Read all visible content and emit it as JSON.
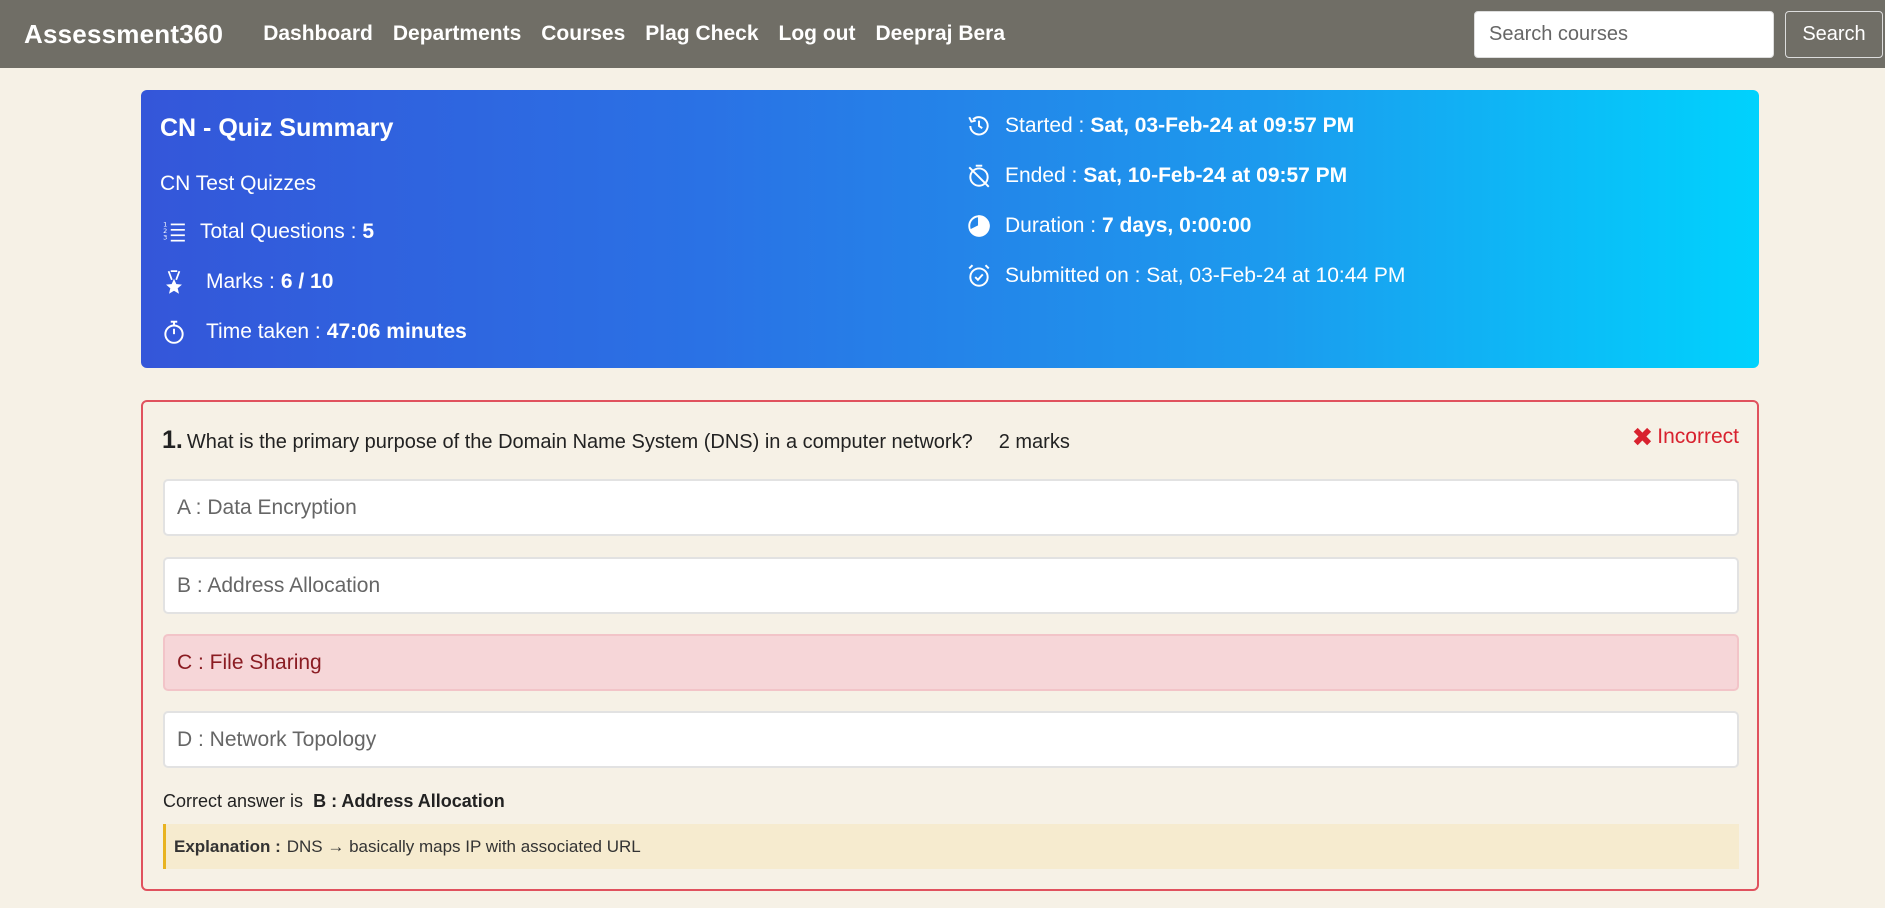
{
  "navbar": {
    "brand": "Assessment360",
    "links": [
      "Dashboard",
      "Departments",
      "Courses",
      "Plag Check",
      "Log out",
      "Deepraj Bera"
    ],
    "search_placeholder": "Search courses",
    "search_button": "Search",
    "bg_color": "#706e66"
  },
  "summary": {
    "title": "CN - Quiz Summary",
    "subtitle": "CN Test Quizzes",
    "total_questions_label": "Total Questions :",
    "total_questions_value": "5",
    "marks_label": "Marks :",
    "marks_value": "6 / 10",
    "time_taken_label": "Time taken :",
    "time_taken_value": "47:06 minutes",
    "started_label": "Started :",
    "started_value": "Sat, 03-Feb-24 at 09:57 PM",
    "ended_label": "Ended :",
    "ended_value": "Sat, 10-Feb-24 at 09:57 PM",
    "duration_label": "Duration :",
    "duration_value": "7 days, 0:00:00",
    "submitted_text": "Submitted on : Sat, 03-Feb-24 at 10:44 PM",
    "icons": [
      "list-numbered-icon",
      "award-icon",
      "stopwatch-icon",
      "history-icon",
      "alarm-off-icon",
      "pie-icon",
      "alarm-check-icon"
    ]
  },
  "question": {
    "number": "1.",
    "text": "What is the primary purpose of the Domain Name System (DNS) in a computer network?",
    "marks": "2 marks",
    "status": "Incorrect",
    "status_color": "#d8222f",
    "options": [
      {
        "label": "A : Data Encryption",
        "state": "normal"
      },
      {
        "label": "B : Address Allocation",
        "state": "normal"
      },
      {
        "label": "C : File Sharing",
        "state": "selected-wrong"
      },
      {
        "label": "D : Network Topology",
        "state": "normal"
      }
    ],
    "correct_prefix": "Correct answer is",
    "correct_answer": "B : Address Allocation",
    "explanation_label": "Explanation :",
    "explanation_text": "DNS → basically maps IP with associated URL"
  }
}
